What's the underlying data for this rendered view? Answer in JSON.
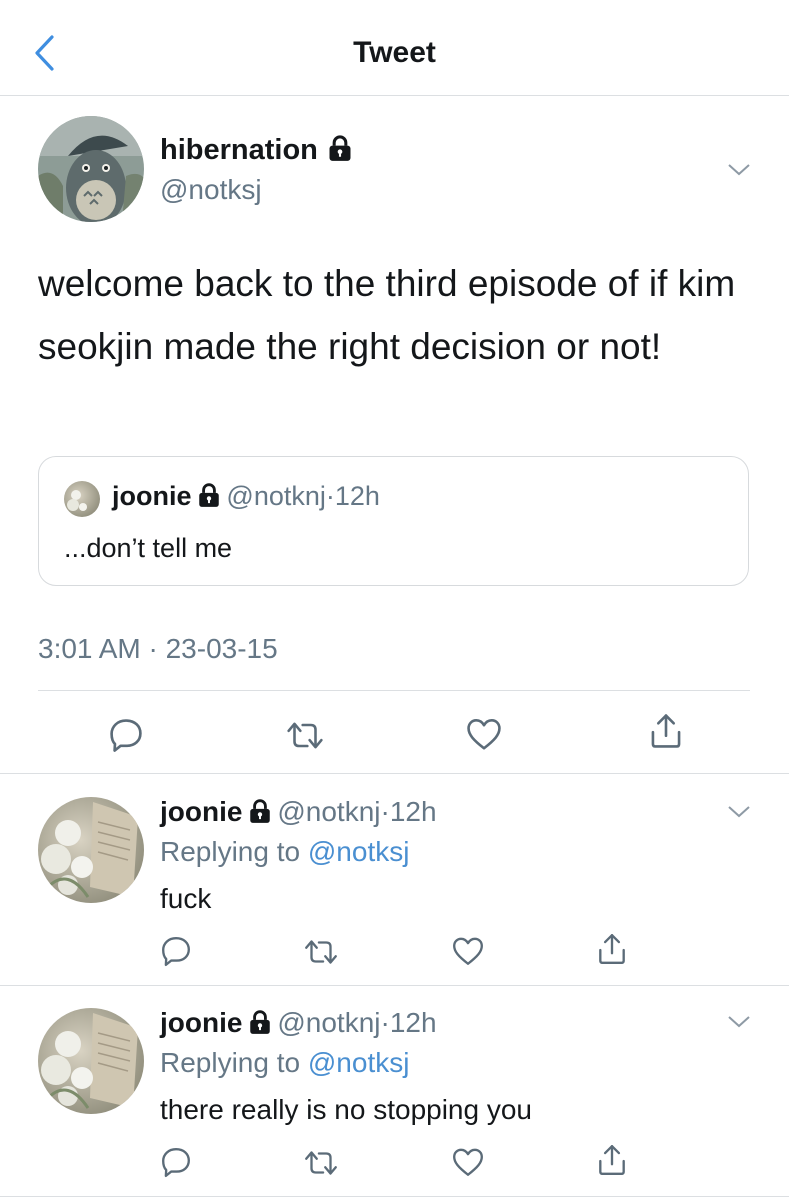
{
  "nav": {
    "title": "Tweet"
  },
  "tweet": {
    "author_name": "hibernation",
    "author_handle": "@notksj",
    "text": "welcome back to the third episode of if kim seokjin made the right decision or not!",
    "timestamp": "3:01 AM · 23-03-15",
    "quoted": {
      "author_name": "joonie",
      "author_handle": "@notknj",
      "time": "12h",
      "text": "...don’t tell me"
    }
  },
  "replies": [
    {
      "author_name": "joonie",
      "author_handle": "@notknj",
      "time": "12h",
      "replying_prefix": "Replying to ",
      "replying_to": "@notksj",
      "text": "fuck"
    },
    {
      "author_name": "joonie",
      "author_handle": "@notknj",
      "time": "12h",
      "replying_prefix": "Replying to ",
      "replying_to": "@notksj",
      "text": "there really is no stopping you"
    }
  ],
  "icons": {
    "back": "chevron-left-icon",
    "lock": "lock-icon",
    "more": "chevron-down-icon",
    "reply": "comment-icon",
    "retweet": "retweet-icon",
    "like": "heart-icon",
    "share": "share-icon"
  },
  "colors": {
    "link": "#4a8fd1",
    "back": "#3f8ee0",
    "secondary_text": "#657786",
    "divider": "#dcdfe2"
  }
}
